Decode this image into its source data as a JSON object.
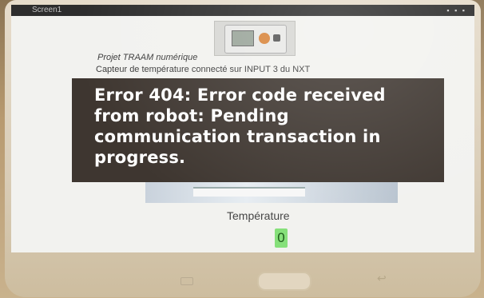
{
  "status_bar": {
    "title": "Screen1",
    "icons": "▪ ▪ ▪"
  },
  "app": {
    "project_title": "Projet TRAAM numérique",
    "sensor_description": "Capteur de température connecté sur INPUT 3 du NXT",
    "temperature_label": "Température",
    "temperature_value": "0"
  },
  "error_toast": {
    "message": "Error 404: Error code received from robot: Pending communication transaction in progress."
  },
  "nav": {
    "back_symbol": "↩"
  },
  "colors": {
    "toast_background": "#3e3630",
    "value_highlight": "#86e07a",
    "screen_background": "#f2f2ef"
  }
}
